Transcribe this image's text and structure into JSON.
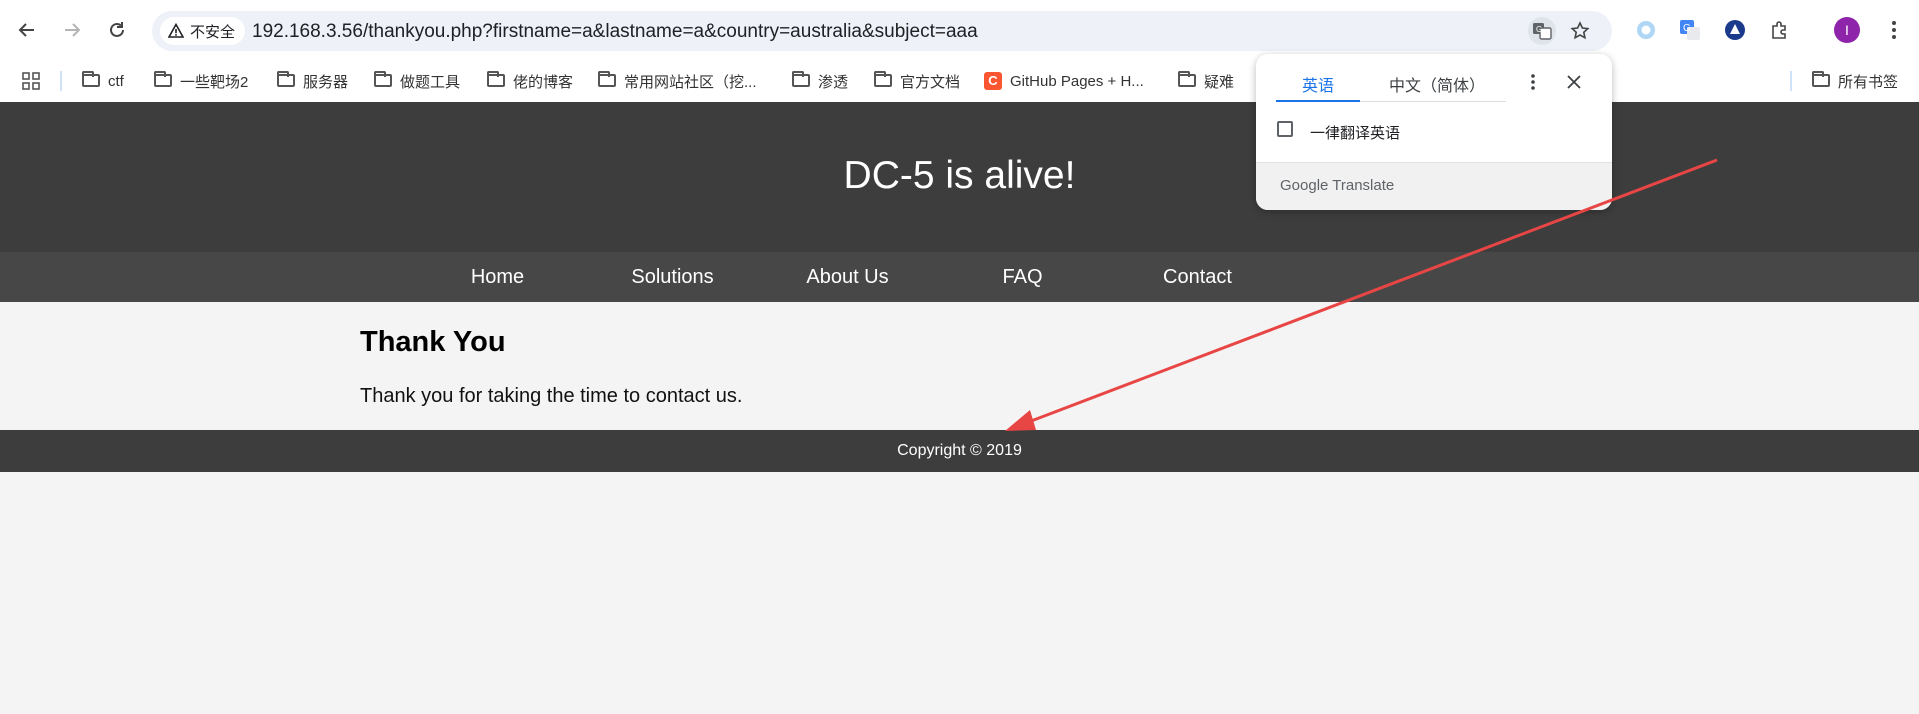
{
  "browser": {
    "security_label": "不安全",
    "url": "192.168.3.56/thankyou.php?firstname=a&lastname=a&country=australia&subject=aaa",
    "profile_initial": "I",
    "bookmarks": [
      {
        "label": "ctf"
      },
      {
        "label": "一些靶场2"
      },
      {
        "label": "服务器"
      },
      {
        "label": "做题工具"
      },
      {
        "label": "佬的博客"
      },
      {
        "label": "常用网站社区（挖..."
      },
      {
        "label": "渗透"
      },
      {
        "label": "官方文档"
      },
      {
        "label": "GitHub Pages + H..."
      },
      {
        "label": "疑难"
      }
    ],
    "all_bookmarks_label": "所有书签"
  },
  "translate_popup": {
    "tab_source": "英语",
    "tab_target": "中文（简体）",
    "always_translate_label": "一律翻译英语",
    "brand": "Google Translate"
  },
  "page": {
    "site_title": "DC-5 is alive!",
    "nav": [
      "Home",
      "Solutions",
      "About Us",
      "FAQ",
      "Contact"
    ],
    "heading": "Thank You",
    "message": "Thank you for taking the time to contact us.",
    "footer": "Copyright © 2019"
  },
  "colors": {
    "header_bg": "#3d3d3d",
    "nav_bg": "#474747",
    "page_bg": "#f4f4f4",
    "annotation_arrow": "#e84545",
    "link_blue": "#1a73e8"
  }
}
